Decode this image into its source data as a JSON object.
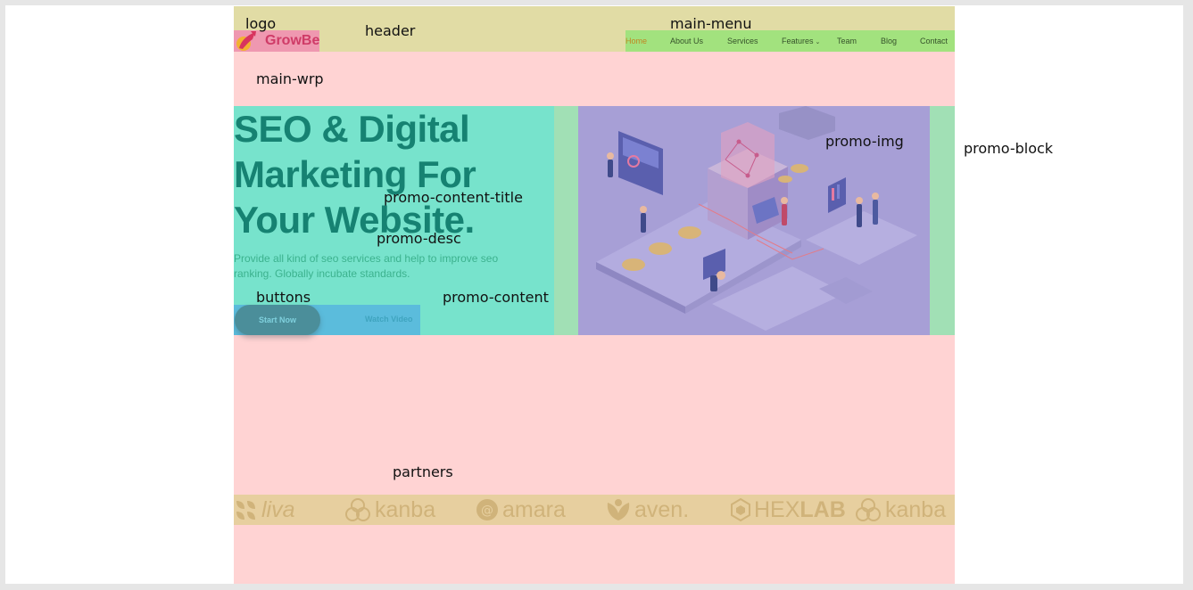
{
  "overlay_labels": {
    "logo": "logo",
    "header": "header",
    "main_menu": "main-menu",
    "main_wrp": "main-wrp",
    "promo_img": "promo-img",
    "promo_block": "promo-block",
    "promo_content_title": "promo-content-title",
    "promo_desc": "promo-desc",
    "buttons": "buttons",
    "promo_content": "promo-content",
    "partners": "partners"
  },
  "brand": {
    "name": "GrowBe",
    "color": "#cf3b67"
  },
  "menu": {
    "items": [
      {
        "label": "Home",
        "active": true
      },
      {
        "label": "About Us"
      },
      {
        "label": "Services"
      },
      {
        "label": "Features",
        "has_dropdown": true,
        "icon": "chevron-down-icon"
      },
      {
        "label": "Team"
      },
      {
        "label": "Blog"
      },
      {
        "label": "Contact"
      }
    ]
  },
  "promo": {
    "title": "SEO & Digital Marketing For Your Website.",
    "description": "Provide all kind of seo services and help to improve seo ranking. Globally incubate standards.",
    "start_label": "Start Now",
    "watch_label": "Watch Video"
  },
  "partners": [
    {
      "name": "liva",
      "icon": "liva-logo-icon"
    },
    {
      "name": "kanba",
      "icon": "kanba-logo-icon"
    },
    {
      "name": "amara",
      "icon": "amara-logo-icon"
    },
    {
      "name": "aven.",
      "icon": "aven-logo-icon"
    },
    {
      "name_part1": "HEX",
      "name_part2": "LAB",
      "icon": "hexlab-logo-icon"
    },
    {
      "name": "kanba",
      "icon": "kanba-logo-icon"
    }
  ],
  "colors": {
    "header": "#e1dca5",
    "menu": "#a2e27e",
    "main": "#ffd3d3",
    "promo_content": "#77e3cc",
    "promo_block": "#a1e0b5",
    "promo_img": "#a79fd6",
    "buttons": "#5bbcdc",
    "partners": "#e7cf9f",
    "title": "#168272"
  }
}
